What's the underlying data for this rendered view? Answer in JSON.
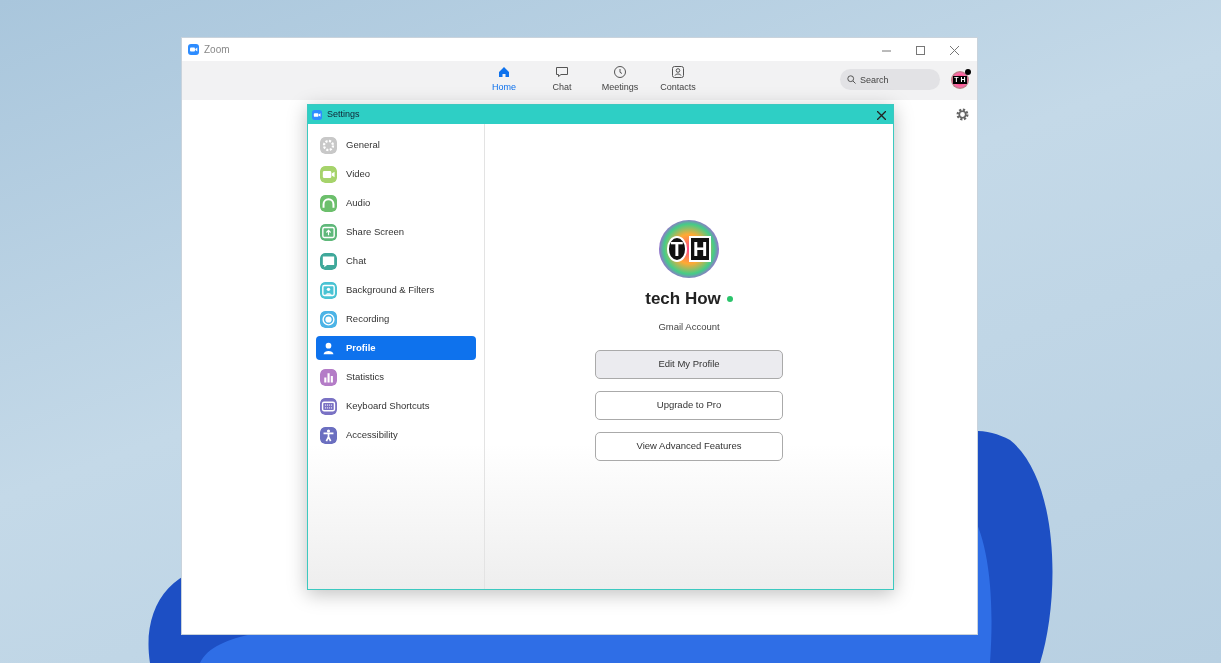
{
  "window": {
    "title": "Zoom"
  },
  "nav_tabs": [
    {
      "label": "Home",
      "selected": true
    },
    {
      "label": "Chat",
      "selected": false
    },
    {
      "label": "Meetings",
      "selected": false
    },
    {
      "label": "Contacts",
      "selected": false
    }
  ],
  "search": {
    "placeholder": "Search"
  },
  "account_avatar": {
    "letters": [
      "T",
      "H"
    ],
    "online": true
  },
  "settings": {
    "title": "Settings",
    "sidebar": {
      "items": [
        {
          "label": "General",
          "color": "#c8c8c8",
          "selected": false
        },
        {
          "label": "Video",
          "color": "#a6d36b",
          "selected": false
        },
        {
          "label": "Audio",
          "color": "#6cbf6c",
          "selected": false
        },
        {
          "label": "Share Screen",
          "color": "#5fb87a",
          "selected": false
        },
        {
          "label": "Chat",
          "color": "#3fa89a",
          "selected": false
        },
        {
          "label": "Background & Filters",
          "color": "#4ac3d3",
          "selected": false
        },
        {
          "label": "Recording",
          "color": "#4db4e6",
          "selected": false
        },
        {
          "label": "Profile",
          "selected": true
        },
        {
          "label": "Statistics",
          "color": "#b47cc7",
          "selected": false
        },
        {
          "label": "Keyboard Shortcuts",
          "color": "#7a72c4",
          "selected": false
        },
        {
          "label": "Accessibility",
          "color": "#6b6fc0",
          "selected": false
        }
      ]
    },
    "profile": {
      "avatar_letters": [
        "T",
        "H"
      ],
      "name": "tech How",
      "online": true,
      "account_type": "Gmail Account",
      "buttons": [
        {
          "label": "Edit My Profile",
          "hovered": true
        },
        {
          "label": "Upgrade to Pro",
          "hovered": false
        },
        {
          "label": "View Advanced Features",
          "hovered": false
        }
      ]
    }
  }
}
